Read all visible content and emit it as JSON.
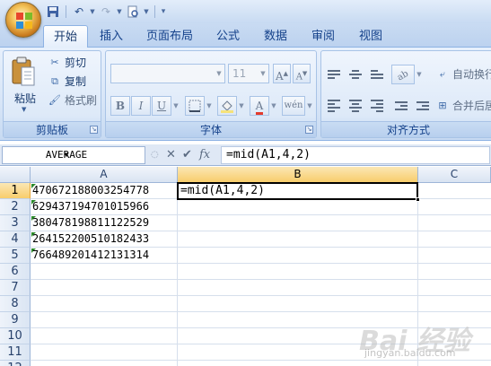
{
  "qat": {
    "icons": [
      "save-icon",
      "undo-icon",
      "redo-icon",
      "print-preview-icon",
      "customize-qat-icon"
    ]
  },
  "tabs": [
    {
      "label": "开始",
      "active": true
    },
    {
      "label": "插入",
      "active": false
    },
    {
      "label": "页面布局",
      "active": false
    },
    {
      "label": "公式",
      "active": false
    },
    {
      "label": "数据",
      "active": false
    },
    {
      "label": "审阅",
      "active": false
    },
    {
      "label": "视图",
      "active": false
    }
  ],
  "ribbon": {
    "clipboard": {
      "label": "剪贴板",
      "paste": "粘贴",
      "cut": "剪切",
      "copy": "复制",
      "format_painter": "格式刷"
    },
    "font": {
      "label": "字体",
      "font_name": "",
      "font_size": "11",
      "bold": "B",
      "italic": "I",
      "underline": "U"
    },
    "alignment": {
      "label": "对齐方式",
      "wrap_text": "自动换行",
      "merge_center": "合并后居"
    }
  },
  "formula_bar": {
    "name_box": "AVERAGE",
    "cancel": "✕",
    "enter": "✔",
    "fx": "fx",
    "formula": "=mid(A1,4,2)"
  },
  "sheet": {
    "columns": [
      "A",
      "B",
      "C"
    ],
    "selected_column": "B",
    "selected_row": 1,
    "rows": [
      "1",
      "2",
      "3",
      "4",
      "5",
      "6",
      "7",
      "8",
      "9",
      "10",
      "11",
      "12"
    ],
    "cells_A": [
      "470672188003254778",
      "629437194701015966",
      "380478198811122529",
      "264152200510182433",
      "766489201412131314"
    ],
    "active_cell": "B1",
    "active_cell_value": "=mid(A1,4,2)"
  },
  "watermark": {
    "text": "Bai 经验",
    "sub": "jingyan.baidu.com"
  }
}
